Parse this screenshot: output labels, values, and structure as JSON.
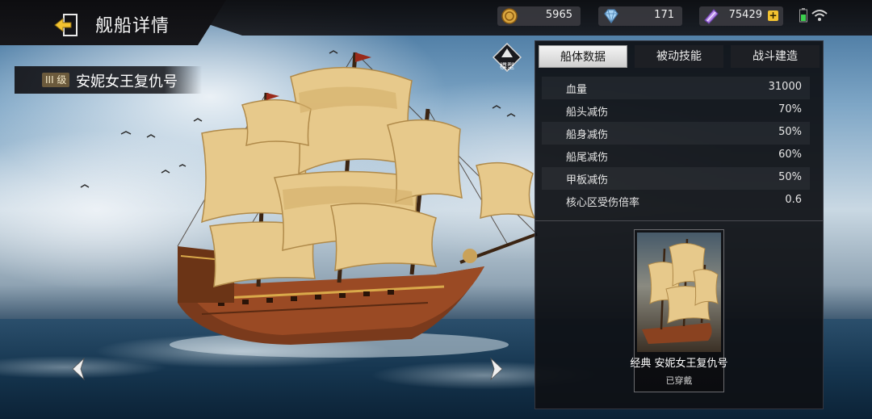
{
  "header": {
    "title": "舰船详情"
  },
  "resources": [
    {
      "name": "coin",
      "icon": "gold-coin-icon",
      "value": "5965"
    },
    {
      "name": "diamond",
      "icon": "diamond-icon",
      "value": "171"
    },
    {
      "name": "crystal",
      "icon": "purple-crystal-icon",
      "value": "75429"
    }
  ],
  "ship": {
    "tier": "III 级",
    "name": "安妮女王复仇号"
  },
  "model_button": {
    "label": "模型"
  },
  "tabs": [
    {
      "label": "船体数据",
      "active": true
    },
    {
      "label": "被动技能",
      "active": false
    },
    {
      "label": "战斗建造",
      "active": false
    }
  ],
  "stats": [
    {
      "label": "血量",
      "value": "31000"
    },
    {
      "label": "船头减伤",
      "value": "70%"
    },
    {
      "label": "船身减伤",
      "value": "50%"
    },
    {
      "label": "船尾减伤",
      "value": "60%"
    },
    {
      "label": "甲板减伤",
      "value": "50%"
    },
    {
      "label": "核心区受伤倍率",
      "value": "0.6"
    }
  ],
  "skin": {
    "name": "经典 安妮女王复仇号",
    "status": "已穿戴"
  },
  "colors": {
    "panel_bg": "#0e1014",
    "accent_gold": "#f2c230",
    "battery_green": "#3ccf4e"
  }
}
